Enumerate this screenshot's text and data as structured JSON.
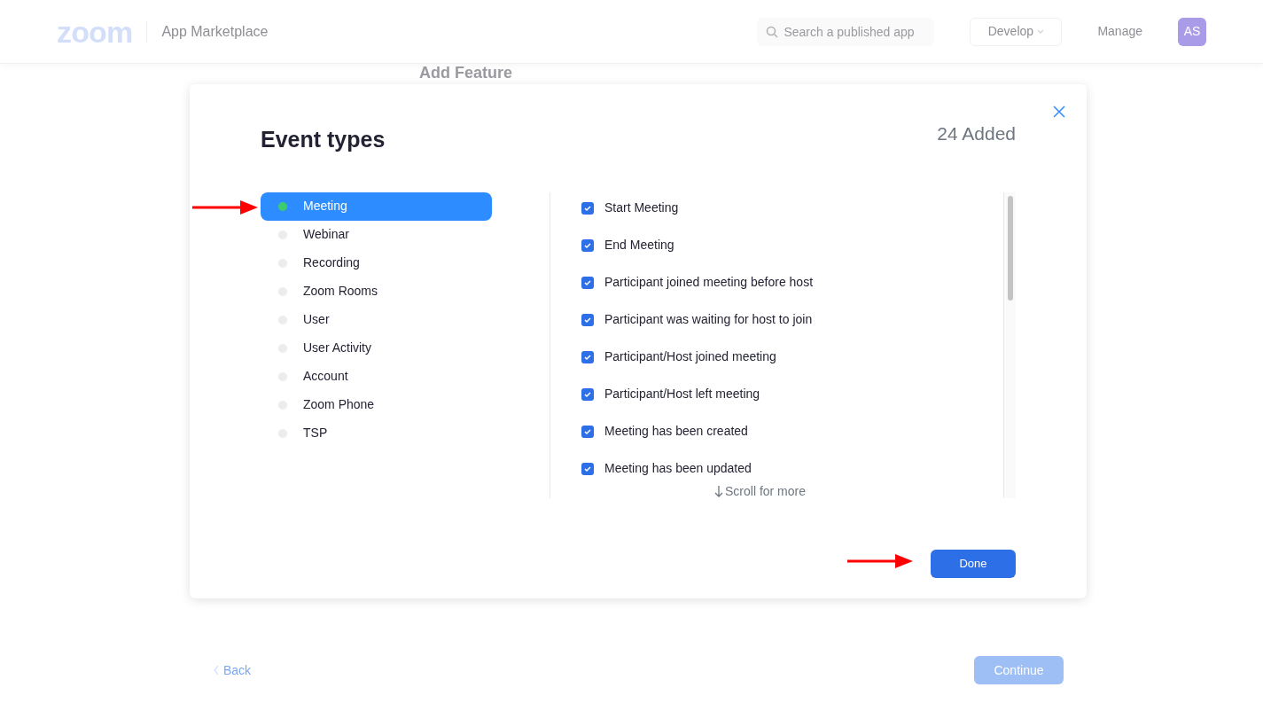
{
  "header": {
    "logo": "zoom",
    "product": "App Marketplace",
    "search": {
      "placeholder": "Search a published app"
    },
    "develop": "Develop",
    "manage": "Manage",
    "avatar": "AS"
  },
  "page": {
    "title": "Add Feature",
    "back": "Back",
    "continue": {
      "label": "Continue",
      "disabled": true
    }
  },
  "dialog": {
    "title": "Event types",
    "count": "24 Added",
    "categories": [
      {
        "label": "Meeting",
        "selected": true
      },
      {
        "label": "Webinar",
        "selected": false
      },
      {
        "label": "Recording",
        "selected": false
      },
      {
        "label": "Zoom Rooms",
        "selected": false
      },
      {
        "label": "User",
        "selected": false
      },
      {
        "label": "User Activity",
        "selected": false
      },
      {
        "label": "Account",
        "selected": false
      },
      {
        "label": "Zoom Phone",
        "selected": false
      },
      {
        "label": "TSP",
        "selected": false
      }
    ],
    "events": [
      {
        "label": "Start Meeting",
        "checked": true
      },
      {
        "label": "End Meeting",
        "checked": true
      },
      {
        "label": "Participant joined meeting before host",
        "checked": true
      },
      {
        "label": "Participant was waiting for host to join",
        "checked": true
      },
      {
        "label": "Participant/Host joined meeting",
        "checked": true
      },
      {
        "label": "Participant/Host left meeting",
        "checked": true
      },
      {
        "label": "Meeting has been created",
        "checked": true
      },
      {
        "label": "Meeting has been updated",
        "checked": true
      }
    ],
    "scroll_hint": "Scroll for more",
    "done": "Done"
  }
}
